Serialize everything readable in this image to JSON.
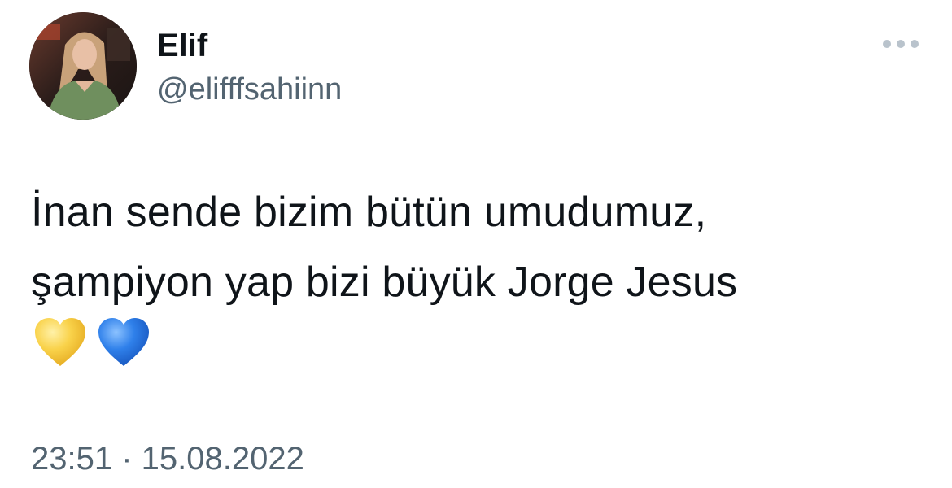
{
  "tweet": {
    "author": {
      "display_name": "Elif",
      "handle": "@elifffsahiinn",
      "avatar_icon": "profile-photo"
    },
    "more_icon": "more-horizontal-icon",
    "text_lines": [
      "İnan sende bizim bütün umudumuz,",
      "şampiyon yap bizi büyük Jorge Jesus"
    ],
    "emojis": [
      "yellow-heart",
      "blue-heart"
    ],
    "timestamp": "23:51 · 15.08.2022"
  },
  "colors": {
    "text_primary": "#0f1419",
    "text_secondary": "#536471",
    "more_dots": "#b9c3cc",
    "yellow_heart": "#f6c634",
    "blue_heart": "#2a7de8"
  }
}
